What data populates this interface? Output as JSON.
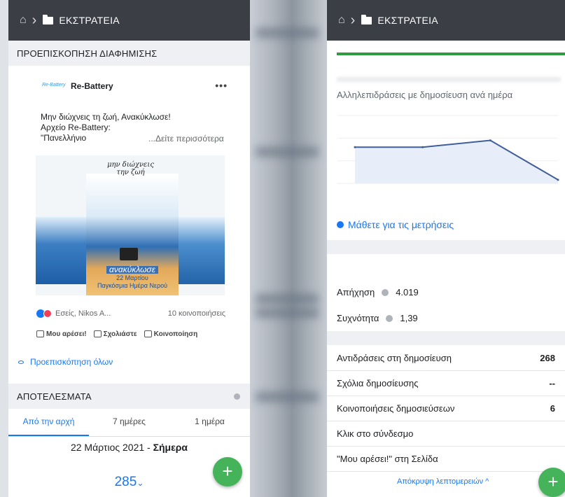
{
  "left": {
    "breadcrumb": "ΕΚΣΤΡΑΤΕΙΑ",
    "preview_header": "ΠΡΟΕΠΙΣΚΟΠΗΣΗ ΔΙΑΦΗΜΙΣΗΣ",
    "post": {
      "logo_text": "Re-Battery",
      "page_name": "Re-Battery",
      "more": "•••",
      "text_line1": "Μην διώχνεις τη ζωή, Ανακύκλωσε!",
      "text_line2": "Αρχείο Re-Battery:",
      "text_line3": "\"Πανελλήνιο",
      "see_more": "...Δείτε περισσότερα",
      "image_headline": "μην διώχνεις την ζωή",
      "image_cap_big": "ανακύκλωσε",
      "image_cap_date": "22 Μαρτίου",
      "image_cap_day": "Παγκόσμια Ημέρα Νερού",
      "reactors": "Εσείς, Nikos A...",
      "shares": "10 κοινοποιήσεις",
      "like": "Μου αρέσει!",
      "comment": "Σχολιάστε",
      "share": "Κοινοποίηση"
    },
    "preview_all": "Προεπισκόπηση όλων",
    "results_header": "ΑΠΟΤΕΛΕΣΜΑΤΑ",
    "tabs": [
      "Από την αρχή",
      "7 ημέρες",
      "1 ημέρα"
    ],
    "date_prefix": "22 Μάρτιος 2021 - ",
    "date_bold": "Σήμερα",
    "total": "285",
    "total_chevron": "⌄",
    "fab_label": "+"
  },
  "right": {
    "breadcrumb": "ΕΚΣΤΡΑΤΕΙΑ",
    "chart_title": "Αλληλεπιδράσεις με δημοσίευση ανά ημέρα",
    "measure_link": "Μάθετε για τις μετρήσεις",
    "reach_label": "Απήχηση",
    "reach_value": "4.019",
    "freq_label": "Συχνότητα",
    "freq_value": "1,39",
    "rows": [
      {
        "label": "Αντιδράσεις στη δημοσίευση",
        "value": "268"
      },
      {
        "label": "Σχόλια δημοσίευσης",
        "value": "--"
      },
      {
        "label": "Κοινοποιήσεις δημοσιεύσεων",
        "value": "6"
      },
      {
        "label": "Κλικ στο σύνδεσμο",
        "value": ""
      },
      {
        "label": "\"Μου αρέσει!\" στη Σελίδα",
        "value": ""
      }
    ],
    "hide_details": "Απόκρυψη λεπτομερειών ^",
    "fab_label": "+"
  },
  "colors": {
    "topbar": "#3b3e45",
    "accent": "#1877f2",
    "fab": "#44b35a",
    "progress": "#2e9c3f"
  },
  "chart_data": {
    "type": "area",
    "x": [
      1,
      2,
      3,
      4
    ],
    "values": [
      80,
      80,
      95,
      8
    ],
    "ylim": [
      0,
      150
    ]
  }
}
